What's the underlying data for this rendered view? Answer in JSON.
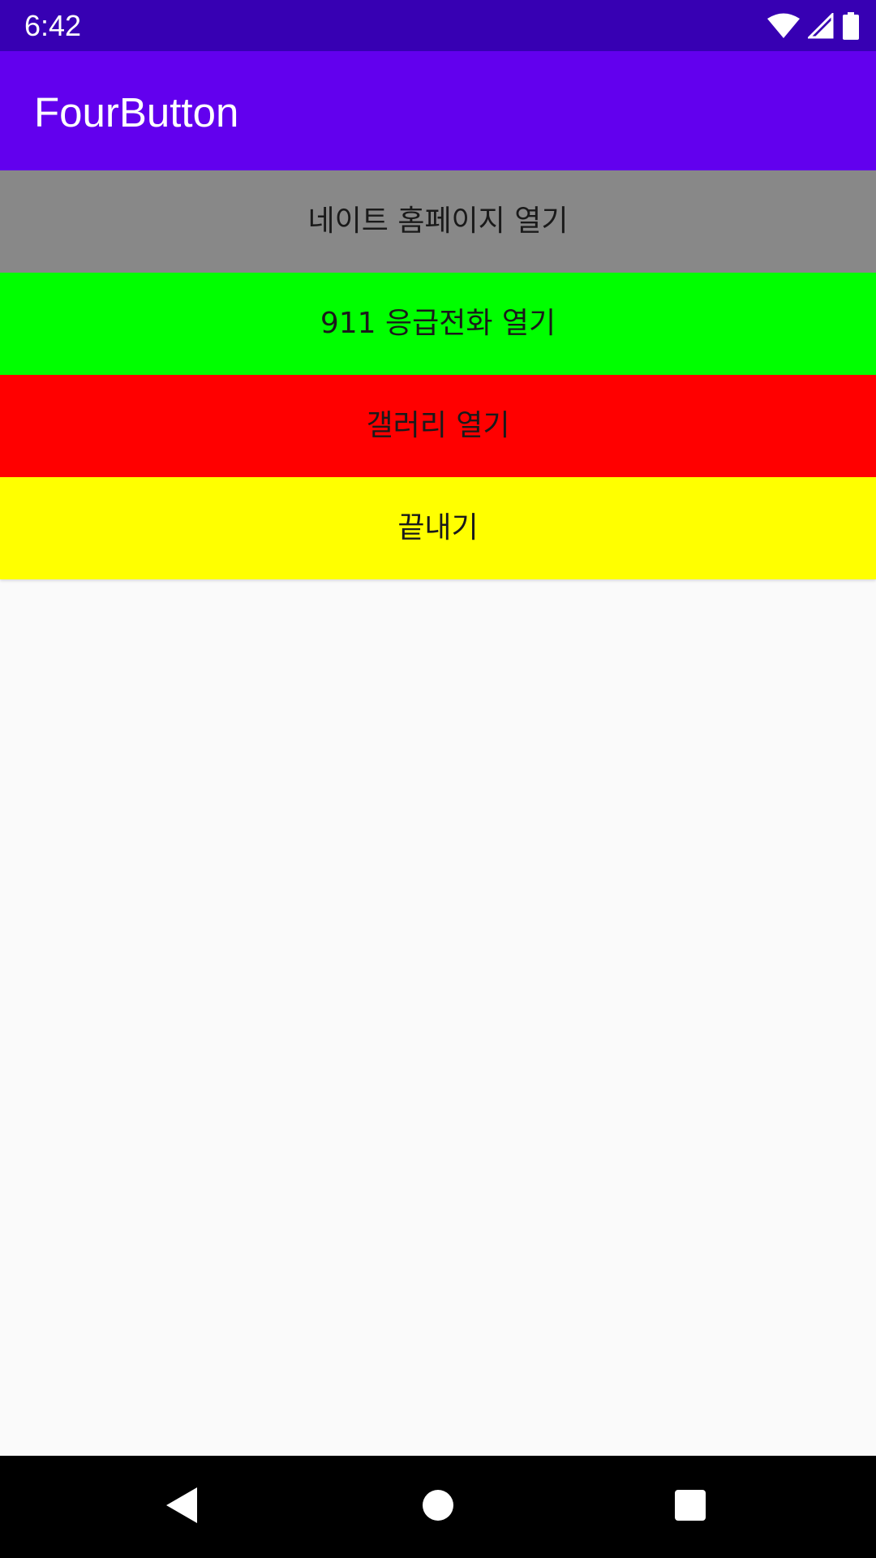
{
  "status_bar": {
    "time": "6:42",
    "background": "#3700b3",
    "icons": [
      "wifi-icon",
      "cell-signal-icon",
      "battery-icon"
    ]
  },
  "app_bar": {
    "title": "FourButton",
    "background": "#6200ee"
  },
  "buttons": [
    {
      "label": "네이트 홈페이지 열기",
      "color": "#888888"
    },
    {
      "label": "911 응급전화 열기",
      "color": "#00ff00"
    },
    {
      "label": "갤러리 열기",
      "color": "#ff0000"
    },
    {
      "label": "끝내기",
      "color": "#ffff00"
    }
  ],
  "nav_bar": {
    "icons": [
      "back-icon",
      "home-icon",
      "recents-icon"
    ]
  }
}
